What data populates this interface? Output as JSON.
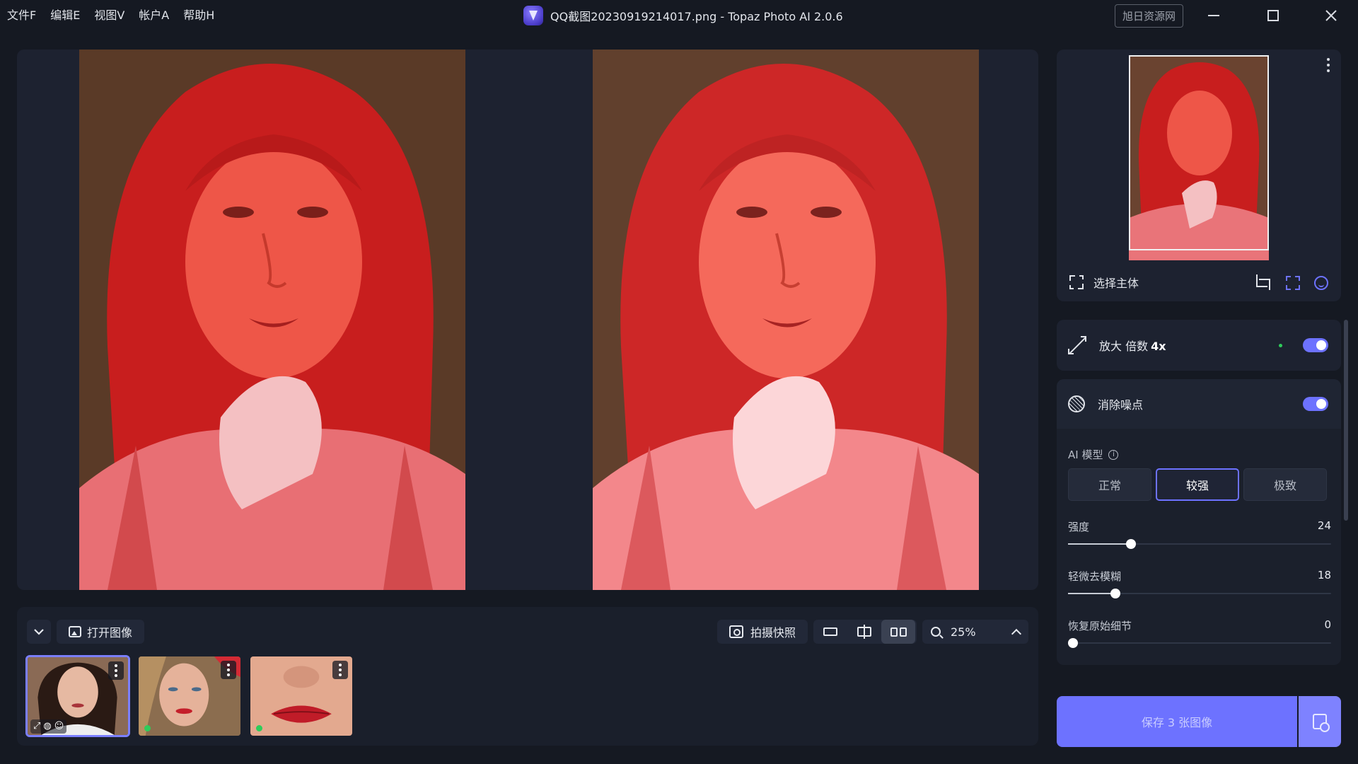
{
  "menu": [
    "文件F",
    "编辑E",
    "视图V",
    "帐户A",
    "帮助H"
  ],
  "window": {
    "title": "QQ截图20230919214017.png - Topaz Photo AI 2.0.6",
    "badge": "旭日资源网"
  },
  "toolbar": {
    "open_image": "打开图像",
    "snapshot": "拍摄快照",
    "zoom": "25%"
  },
  "thumbnails": [
    {
      "selected": true,
      "badges": [
        "upscale-icon",
        "denoise-icon",
        "face-icon"
      ]
    },
    {
      "selected": false,
      "status": "processed"
    },
    {
      "selected": false,
      "status": "processed"
    }
  ],
  "navigator": {
    "select_subject": "选择主体"
  },
  "upscale": {
    "label": "放大 倍数",
    "factor": "4x",
    "enabled": true
  },
  "denoise": {
    "title": "消除噪点",
    "enabled": true,
    "model_label": "AI 模型",
    "model_options": [
      "正常",
      "较强",
      "极致"
    ],
    "selected_model": "较强",
    "sliders": [
      {
        "label": "强度",
        "value": 24,
        "fraction": 0.24
      },
      {
        "label": "轻微去模糊",
        "value": 18,
        "fraction": 0.18
      },
      {
        "label": "恢复原始细节",
        "value": 0,
        "fraction": 0.0
      }
    ]
  },
  "save": {
    "label": "保存 3 张图像"
  },
  "colors": {
    "accent": "#6d72ff",
    "background": "#151922",
    "panel": "#1d2230",
    "status_green": "#2ecc5a"
  }
}
